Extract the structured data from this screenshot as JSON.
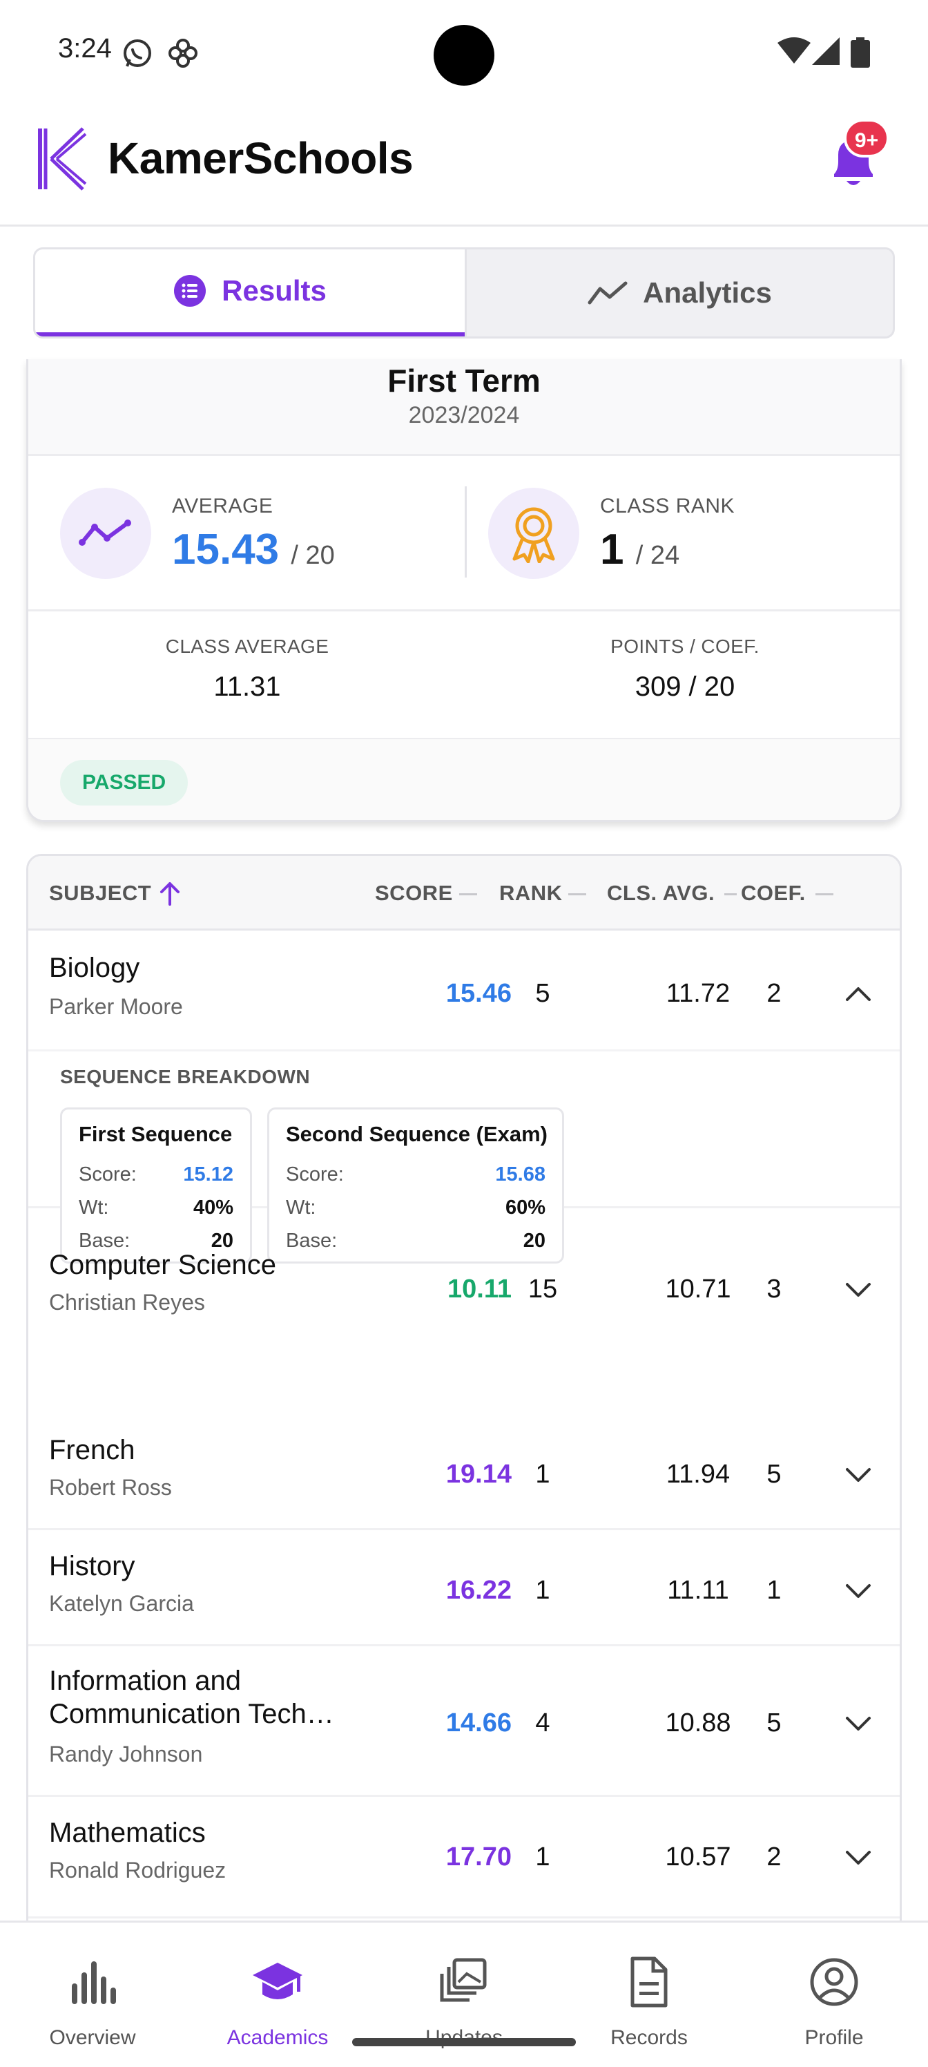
{
  "status_bar": {
    "time": "3:24"
  },
  "header": {
    "app_name": "KamerSchools",
    "notification_badge": "9+"
  },
  "tabs": [
    {
      "label": "Results",
      "icon": "list-icon",
      "active": true
    },
    {
      "label": "Analytics",
      "icon": "trend-line-icon",
      "active": false
    }
  ],
  "summary": {
    "term": "First Term",
    "year": "2023/2024",
    "average_label": "AVERAGE",
    "average_value": "15.43",
    "average_den": "/ 20",
    "rank_label": "CLASS RANK",
    "rank_value": "1",
    "rank_den": "/ 24",
    "class_avg_label": "CLASS AVERAGE",
    "class_avg_value": "11.31",
    "points_label": "POINTS / COEF.",
    "points_value": "309 / 20",
    "status": "PASSED"
  },
  "table": {
    "headers": {
      "subject": "SUBJECT",
      "score": "SCORE",
      "rank": "RANK",
      "cls_avg": "CLS. AVG.",
      "coef": "COEF."
    },
    "breakdown_title": "SEQUENCE BREAKDOWN",
    "rows": [
      {
        "subject": "Biology",
        "teacher": "Parker Moore",
        "score": "15.46",
        "score_color": "#2f7be6",
        "rank": "5",
        "cls_avg": "11.72",
        "coef": "2",
        "expanded": true
      },
      {
        "subject": "Computer Science",
        "teacher": "Christian Reyes",
        "score": "10.11",
        "score_color": "#17a86b",
        "rank": "15",
        "cls_avg": "10.71",
        "coef": "3",
        "expanded": false
      },
      {
        "subject": "French",
        "teacher": "Robert Ross",
        "score": "19.14",
        "score_color": "#7b33e0",
        "rank": "1",
        "cls_avg": "11.94",
        "coef": "5",
        "expanded": false
      },
      {
        "subject": "History",
        "teacher": "Katelyn Garcia",
        "score": "16.22",
        "score_color": "#7b33e0",
        "rank": "1",
        "cls_avg": "11.11",
        "coef": "1",
        "expanded": false
      },
      {
        "subject_line1": "Information and",
        "subject_line2": "Communication Tech…",
        "teacher": "Randy Johnson",
        "score": "14.66",
        "score_color": "#2f7be6",
        "rank": "4",
        "cls_avg": "10.88",
        "coef": "5",
        "expanded": false
      },
      {
        "subject": "Mathematics",
        "teacher": "Ronald Rodriguez",
        "score": "17.70",
        "score_color": "#7b33e0",
        "rank": "1",
        "cls_avg": "10.57",
        "coef": "2",
        "expanded": false
      }
    ],
    "sequences": [
      {
        "title": "First Sequence",
        "score_label": "Score:",
        "score": "15.12",
        "wt_label": "Wt:",
        "wt": "40%",
        "base_label": "Base:",
        "base": "20"
      },
      {
        "title": "Second Sequence (Exam)",
        "score_label": "Score:",
        "score": "15.68",
        "wt_label": "Wt:",
        "wt": "60%",
        "base_label": "Base:",
        "base": "20"
      }
    ]
  },
  "bottom_nav": [
    {
      "label": "Overview",
      "icon": "bar-chart-icon",
      "active": false
    },
    {
      "label": "Academics",
      "icon": "graduation-cap-icon",
      "active": true
    },
    {
      "label": "Updates",
      "icon": "stacked-images-icon",
      "active": false
    },
    {
      "label": "Records",
      "icon": "document-icon",
      "active": false
    },
    {
      "label": "Profile",
      "icon": "user-circle-icon",
      "active": false
    }
  ],
  "colors": {
    "accent": "#7b33e0",
    "blue": "#2f7be6",
    "green": "#17a86b",
    "badge_red": "#e8344e",
    "gold": "#f0a020"
  }
}
